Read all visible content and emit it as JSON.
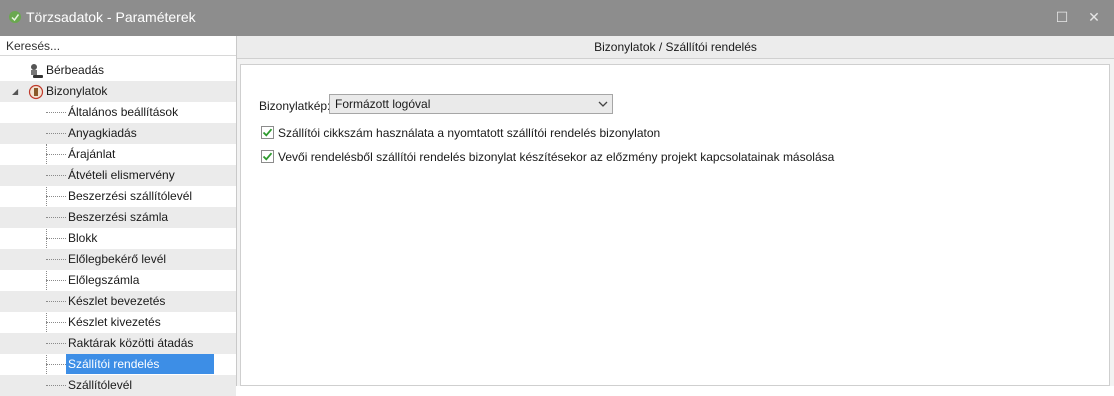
{
  "window": {
    "title": "Törzsadatok - Paraméterek",
    "controls": {
      "maximize": "☐",
      "close": "✕"
    }
  },
  "search": {
    "placeholder": "Keresés..."
  },
  "tree": {
    "items": [
      {
        "label": "Bérbeadás",
        "level": 0,
        "icon": "rental-icon",
        "expanded": false
      },
      {
        "label": "Bizonylatok",
        "level": 0,
        "icon": "documents-icon",
        "expanded": true,
        "expander": "◢"
      },
      {
        "label": "Általános beállítások",
        "level": 1
      },
      {
        "label": "Anyagkiadás",
        "level": 1
      },
      {
        "label": "Árajánlat",
        "level": 1
      },
      {
        "label": "Átvételi elismervény",
        "level": 1
      },
      {
        "label": "Beszerzési szállítólevél",
        "level": 1
      },
      {
        "label": "Beszerzési számla",
        "level": 1
      },
      {
        "label": "Blokk",
        "level": 1
      },
      {
        "label": "Előlegbekérő levél",
        "level": 1
      },
      {
        "label": "Előlegszámla",
        "level": 1
      },
      {
        "label": "Készlet bevezetés",
        "level": 1
      },
      {
        "label": "Készlet kivezetés",
        "level": 1
      },
      {
        "label": "Raktárak közötti átadás",
        "level": 1
      },
      {
        "label": "Szállítói rendelés",
        "level": 1,
        "selected": true
      },
      {
        "label": "Szállítólevél",
        "level": 1
      }
    ]
  },
  "panel": {
    "breadcrumb": "Bizonylatok / Szállítói rendelés",
    "fields": {
      "bizonylatkep_label": "Bizonylatkép:",
      "bizonylatkep_value": "Formázott logóval"
    },
    "checkboxes": [
      {
        "label": "Szállítói cikkszám használata a nyomtatott szállítói rendelés bizonylaton",
        "checked": true
      },
      {
        "label": "Vevői rendelésből szállítói rendelés bizonylat készítésekor az előzmény projekt kapcsolatainak másolása",
        "checked": true
      }
    ]
  },
  "colors": {
    "titlebar": "#8d8d8d",
    "selection": "#3d8ee6",
    "check": "#2e9a2e"
  }
}
